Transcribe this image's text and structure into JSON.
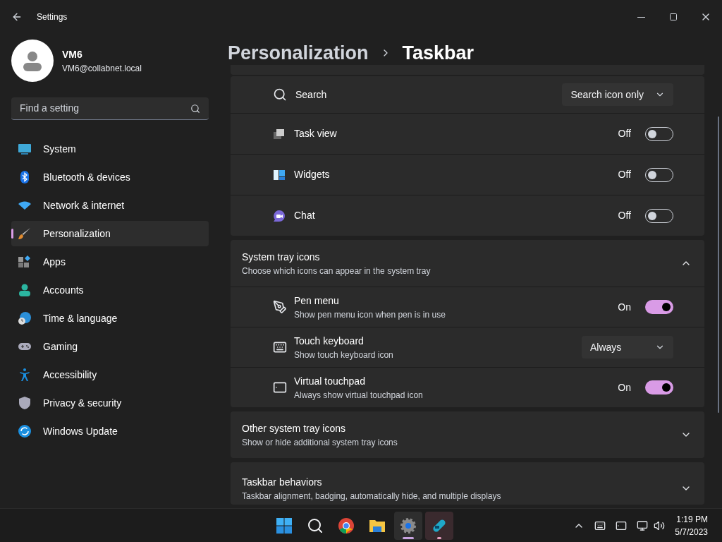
{
  "window": {
    "title": "Settings"
  },
  "user": {
    "name": "VM6",
    "email": "VM6@collabnet.local"
  },
  "search": {
    "placeholder": "Find a setting"
  },
  "nav": [
    {
      "label": "System",
      "selected": false
    },
    {
      "label": "Bluetooth & devices",
      "selected": false
    },
    {
      "label": "Network & internet",
      "selected": false
    },
    {
      "label": "Personalization",
      "selected": true
    },
    {
      "label": "Apps",
      "selected": false
    },
    {
      "label": "Accounts",
      "selected": false
    },
    {
      "label": "Time & language",
      "selected": false
    },
    {
      "label": "Gaming",
      "selected": false
    },
    {
      "label": "Accessibility",
      "selected": false
    },
    {
      "label": "Privacy & security",
      "selected": false
    },
    {
      "label": "Windows Update",
      "selected": false
    }
  ],
  "breadcrumb": [
    "Personalization",
    "Taskbar"
  ],
  "taskbar_items": [
    {
      "kind": "dropdown",
      "label": "Search",
      "value": "Search icon only"
    },
    {
      "kind": "toggle",
      "label": "Task view",
      "on": false,
      "state": "Off"
    },
    {
      "kind": "toggle",
      "label": "Widgets",
      "on": false,
      "state": "Off"
    },
    {
      "kind": "toggle",
      "label": "Chat",
      "on": false,
      "state": "Off"
    }
  ],
  "sections": [
    {
      "title": "System tray icons",
      "subtitle": "Choose which icons can appear in the system tray",
      "expanded": true,
      "rows": [
        {
          "kind": "toggle",
          "label": "Pen menu",
          "subtitle": "Show pen menu icon when pen is in use",
          "on": true,
          "state": "On"
        },
        {
          "kind": "dropdown",
          "label": "Touch keyboard",
          "subtitle": "Show touch keyboard icon",
          "value": "Always"
        },
        {
          "kind": "toggle",
          "label": "Virtual touchpad",
          "subtitle": "Always show virtual touchpad icon",
          "on": true,
          "state": "On"
        }
      ]
    },
    {
      "title": "Other system tray icons",
      "subtitle": "Show or hide additional system tray icons",
      "expanded": false
    },
    {
      "title": "Taskbar behaviors",
      "subtitle": "Taskbar alignment, badging, automatically hide, and multiple displays",
      "expanded": false
    }
  ],
  "taskbar": {
    "apps": [
      {
        "running": false
      },
      {
        "running": false
      },
      {
        "running": false
      },
      {
        "running": false
      },
      {
        "running": true
      },
      {
        "running": true
      }
    ],
    "time": "1:19 PM",
    "date": "5/7/2023"
  }
}
